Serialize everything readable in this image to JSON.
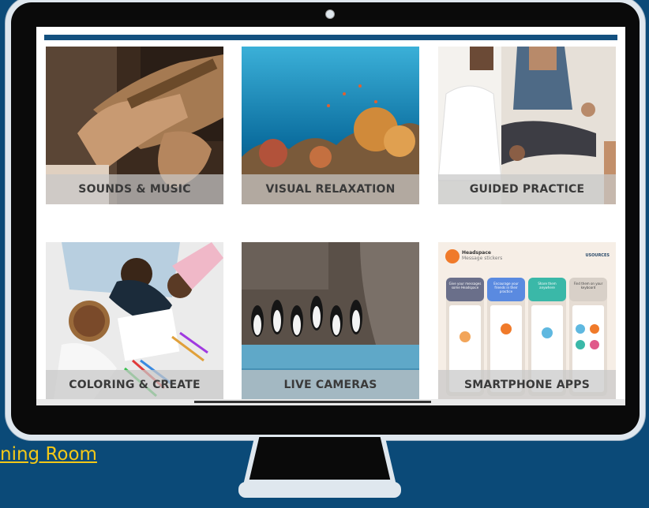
{
  "screen": {
    "tiles": [
      {
        "label": "SOUNDS & MUSIC"
      },
      {
        "label": "VISUAL RELAXATION"
      },
      {
        "label": "GUIDED PRACTICE"
      },
      {
        "label": "COLORING & CREATE"
      },
      {
        "label": "LIVE CAMERAS"
      },
      {
        "label": "SMARTPHONE APPS"
      }
    ]
  },
  "app_preview": {
    "brand": "Headspace",
    "subtitle": "Message stickers",
    "corner_logo": "USOURCES",
    "steps": [
      "Give your messages some Headspace",
      "Encourage your friends in their practice",
      "Share them anywhere",
      "Find them on your keyboard"
    ]
  },
  "footer_link": {
    "label": "ning Room"
  },
  "colors": {
    "background": "#0b4a78",
    "link": "#f3c818",
    "topbar": "#13507f"
  }
}
